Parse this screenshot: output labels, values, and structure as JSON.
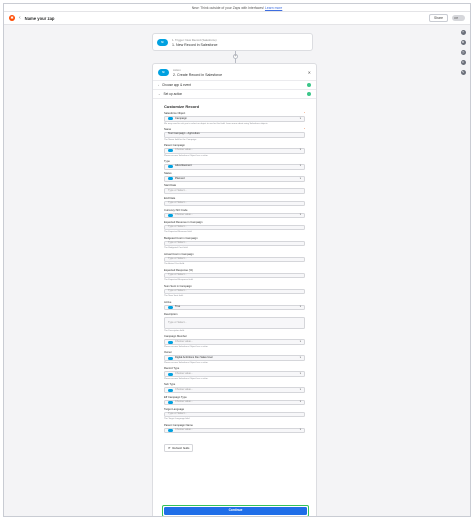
{
  "banner": {
    "text": "New: Think outside of your Zaps with Interfaces!",
    "link": "Learn more"
  },
  "topbar": {
    "logo": "zapier-logo",
    "zap_name": "Name your zap",
    "share_label": "Share",
    "toggle_label": "Off"
  },
  "trigger_step": {
    "kicker": "1. Trigger: New Record (Salesforce)",
    "title": "1. New Record in Salesforce",
    "app_badge": "SF"
  },
  "action_step": {
    "kicker": "Action",
    "title": "2. Create Record in Salesforce",
    "app_badge": "SF",
    "sections": [
      {
        "label": "Choose app & event"
      },
      {
        "label": "Choose account"
      },
      {
        "label": "Set up action"
      }
    ],
    "form": {
      "title": "Customize Record",
      "fields": [
        {
          "label": "Salesforce Object",
          "required": true,
          "value": "Campaign",
          "kind": "select",
          "filled": true,
          "help": "We may need to ask you to select an object to use for this field. Learn more about using Salesforce objects."
        },
        {
          "label": "Name",
          "required": true,
          "value": "Test Campaign - Agriculture",
          "kind": "text",
          "filled": true,
          "help": "The Name field for the Campaign."
        },
        {
          "label": "Parent Campaign",
          "required": false,
          "value": "Choose value...",
          "kind": "select",
          "filled": false,
          "help": "Please ensure Salesforce Object has a value."
        },
        {
          "label": "Type",
          "required": false,
          "value": "Advertisement",
          "kind": "select",
          "filled": true,
          "help": ""
        },
        {
          "label": "Status",
          "required": false,
          "value": "Planned",
          "kind": "select",
          "filled": true,
          "help": ""
        },
        {
          "label": "Start Date",
          "required": false,
          "value": "Type or Select...",
          "kind": "text",
          "filled": false,
          "help": ""
        },
        {
          "label": "End Date",
          "required": false,
          "value": "Type or Select...",
          "kind": "text",
          "filled": false,
          "help": ""
        },
        {
          "label": "Currency ISO Code",
          "required": false,
          "value": "Choose value...",
          "kind": "select",
          "filled": false,
          "help": ""
        },
        {
          "label": "Expected Revenue in Campaign",
          "required": false,
          "value": "Type or Select...",
          "kind": "text",
          "filled": false,
          "help": "The Expected Revenue field."
        },
        {
          "label": "Budgeted Cost in Campaign",
          "required": false,
          "value": "Type or Select...",
          "kind": "text",
          "filled": false,
          "help": "The Budgeted Cost field."
        },
        {
          "label": "Actual Cost in Campaign",
          "required": false,
          "value": "Type or Select...",
          "kind": "text",
          "filled": false,
          "help": "The Actual Cost field."
        },
        {
          "label": "Expected Response (%)",
          "required": false,
          "value": "Type or Select...",
          "kind": "text",
          "filled": false,
          "help": "The Expected Response field."
        },
        {
          "label": "Num Sent in Campaign",
          "required": false,
          "value": "Type or Select...",
          "kind": "text",
          "filled": false,
          "help": "The Num Sent field."
        },
        {
          "label": "Active",
          "required": false,
          "value": "True",
          "kind": "select",
          "filled": true,
          "help": ""
        },
        {
          "label": "Description",
          "required": false,
          "value": "Type or Select...",
          "kind": "textarea",
          "filled": false,
          "help": "The Description field."
        },
        {
          "label": "Campaign Member",
          "required": false,
          "value": "Choose value...",
          "kind": "select",
          "filled": false,
          "help": "Please ensure Salesforce Object has a value."
        },
        {
          "label": "Owner",
          "required": false,
          "value": "Digital Ambitions Dev Sales User",
          "kind": "select",
          "filled": true,
          "help": "Please ensure Salesforce Object has a value."
        },
        {
          "label": "Record Type",
          "required": false,
          "value": "Choose value...",
          "kind": "select",
          "filled": false,
          "help": "Please ensure Salesforce Object has a value."
        },
        {
          "label": "Sub Type",
          "required": false,
          "value": "Choose value...",
          "kind": "select",
          "filled": false,
          "help": ""
        },
        {
          "label": "Eff Campaign Type",
          "required": false,
          "value": "Choose value...",
          "kind": "select",
          "filled": false,
          "help": ""
        },
        {
          "label": "Target Language",
          "required": false,
          "value": "Type or Select...",
          "kind": "text",
          "filled": false,
          "help": "The Target Language field."
        },
        {
          "label": "Parent Campaign Name",
          "required": false,
          "value": "Choose value...",
          "kind": "select",
          "filled": false,
          "help": ""
        }
      ],
      "refresh_label": "Refresh fields"
    },
    "continue_label": "Continue"
  },
  "rail_icons": [
    "help-icon",
    "settings-icon",
    "history-icon",
    "versions-icon",
    "comment-icon"
  ],
  "colors": {
    "accent": "#1f6ee8",
    "success": "#3cc68a",
    "salesforce": "#00a1e0",
    "brand": "#ff4a00"
  }
}
